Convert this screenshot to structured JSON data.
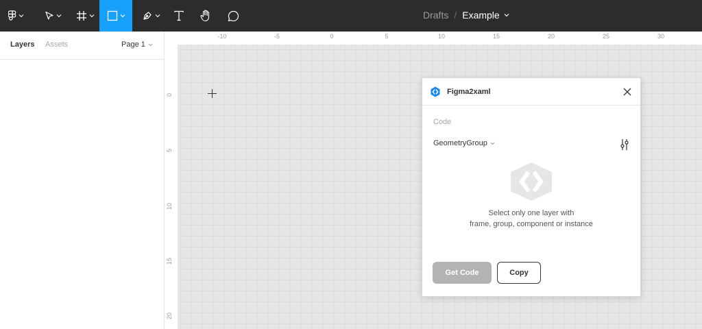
{
  "toolbar": {
    "tools": [
      {
        "id": "main-menu",
        "icon": "figma-logo-icon"
      },
      {
        "id": "move",
        "icon": "move-cursor-icon"
      },
      {
        "id": "frame",
        "icon": "frame-hash-icon"
      },
      {
        "id": "rectangle",
        "icon": "rectangle-icon",
        "active": true
      },
      {
        "id": "pen",
        "icon": "pen-icon"
      },
      {
        "id": "text",
        "icon": "text-icon"
      },
      {
        "id": "hand",
        "icon": "hand-icon"
      },
      {
        "id": "comment",
        "icon": "comment-icon"
      }
    ],
    "active_color": "#18a0fb",
    "bg_color": "#2c2c2c"
  },
  "title": {
    "drafts": "Drafts",
    "separator": "/",
    "file": "Example"
  },
  "left_panel": {
    "tab_layers": "Layers",
    "tab_assets": "Assets",
    "page": "Page 1"
  },
  "rulers": {
    "top": [
      "-10",
      "-5",
      "0",
      "5",
      "10",
      "15",
      "20",
      "25",
      "30"
    ],
    "left": [
      "0",
      "5",
      "10",
      "15",
      "20"
    ]
  },
  "plugin": {
    "title": "Figma2xaml",
    "code_label": "Code",
    "format": "GeometryGroup",
    "message_line1": "Select only one layer with",
    "message_line2": "frame, group, component or instance",
    "get_code": "Get Code",
    "copy": "Copy",
    "logo_color": "#1e88e5"
  }
}
